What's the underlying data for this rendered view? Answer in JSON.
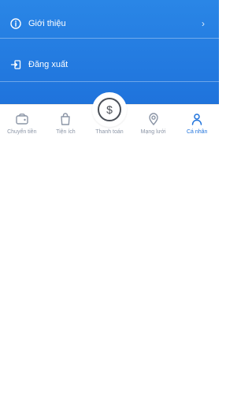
{
  "menu": {
    "items": [
      {
        "label": "Giới thiệu",
        "icon": "info-icon",
        "has_chevron": true
      },
      {
        "label": "Đăng xuất",
        "icon": "logout-icon",
        "has_chevron": false
      }
    ]
  },
  "tabbar": {
    "active_color": "#1f73dc",
    "inactive_color": "#8b95a6",
    "tabs": [
      {
        "label": "Chuyển tiền",
        "icon": "wallet-transfer-icon"
      },
      {
        "label": "Tiện ích",
        "icon": "shopping-bag-icon"
      },
      {
        "label": "Thanh toán",
        "icon": "dollar-circle-icon"
      },
      {
        "label": "Mạng lưới",
        "icon": "location-pin-icon"
      },
      {
        "label": "Cá nhân",
        "icon": "user-icon"
      }
    ]
  }
}
